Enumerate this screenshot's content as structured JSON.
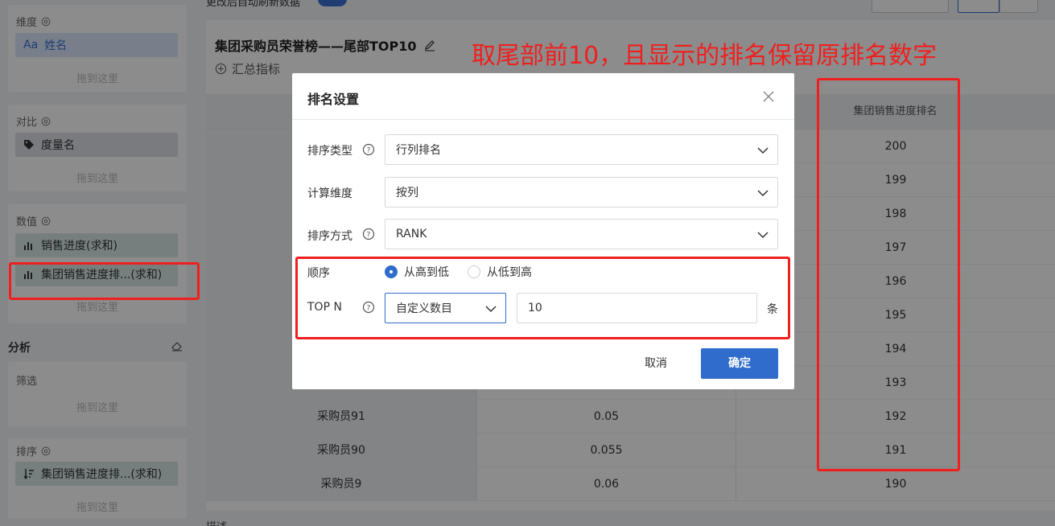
{
  "left": {
    "dimension": {
      "title": "维度",
      "field_icon": "Aa",
      "field": "姓名",
      "drop_hint": "拖到这里"
    },
    "compare": {
      "title": "对比",
      "field": "度量名",
      "drop_hint": "拖到这里"
    },
    "values": {
      "title": "数值",
      "fields": [
        "销售进度(求和)",
        "集团销售进度排...(求和)"
      ],
      "drop_hint": "拖到这里"
    },
    "analysis": {
      "title": "分析"
    },
    "filter": {
      "title": "筛选",
      "drop_hint": "拖到这里"
    },
    "sort": {
      "title": "排序",
      "field": "集团销售进度排...(求和)",
      "drop_hint": "拖到这里"
    }
  },
  "main": {
    "topbar_label": "更改后自动刷新数据",
    "card_title": "集团采购员荣誉榜——尾部TOP10",
    "summary_label": "汇总指标",
    "rank_header": "集团销售进度排名",
    "rows": [
      {
        "name": "",
        "value": "",
        "rank": "200"
      },
      {
        "name": "",
        "value": "",
        "rank": "199"
      },
      {
        "name": "",
        "value": "",
        "rank": "198"
      },
      {
        "name": "",
        "value": "",
        "rank": "197"
      },
      {
        "name": "",
        "value": "",
        "rank": "196"
      },
      {
        "name": "",
        "value": "",
        "rank": "195"
      },
      {
        "name": "",
        "value": "",
        "rank": "194"
      },
      {
        "name": "",
        "value": "",
        "rank": "193"
      },
      {
        "name": "采购员91",
        "value": "0.05",
        "rank": "192"
      },
      {
        "name": "采购员90",
        "value": "0.055",
        "rank": "191"
      },
      {
        "name": "采购员9",
        "value": "0.06",
        "rank": "190"
      }
    ],
    "bottom_label": "描述"
  },
  "modal": {
    "title": "排名设置",
    "sort_type": {
      "label": "排序类型",
      "value": "行列排名"
    },
    "calc_dim": {
      "label": "计算维度",
      "value": "按列"
    },
    "sort_method": {
      "label": "排序方式",
      "value": "RANK"
    },
    "order": {
      "label": "顺序",
      "opt_desc": "从高到低",
      "opt_asc": "从低到高"
    },
    "topn": {
      "label": "TOP N",
      "mode": "自定义数目",
      "count": "10",
      "unit": "条"
    },
    "cancel": "取消",
    "ok": "确定"
  },
  "annotation": {
    "text": "取尾部前10，且显示的排名保留原排名数字",
    "color": "#f01f1f"
  },
  "colors": {
    "primary": "#2f6ccb",
    "annotation": "#f01f1f"
  }
}
